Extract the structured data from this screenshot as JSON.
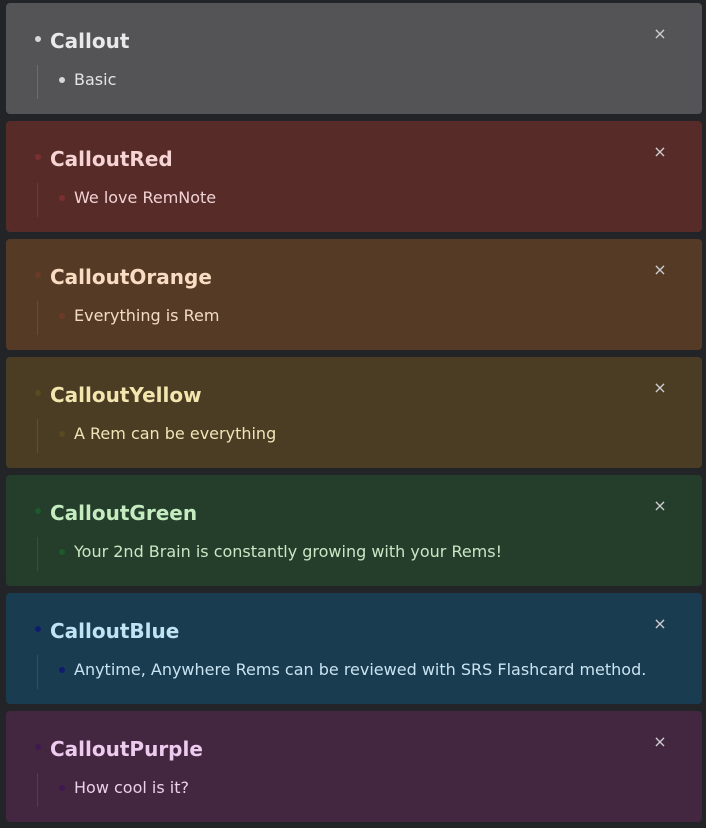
{
  "callouts": [
    {
      "title": "Callout",
      "body": "Basic",
      "close": "×",
      "colors": {
        "bg": "#545456",
        "title": "#e9e9ec",
        "text": "#e4e4e7",
        "bullet": "#d7d7da",
        "line": "#6c6c6f"
      }
    },
    {
      "title": "CalloutRed",
      "body": "We love RemNote",
      "close": "×",
      "colors": {
        "bg": "#562b28",
        "title": "#f6d4d4",
        "text": "#f1d3d3",
        "bullet": "#7c2e30",
        "line": "#6e3b38"
      }
    },
    {
      "title": "CalloutOrange",
      "body": "Everything is Rem",
      "close": "×",
      "colors": {
        "bg": "#553b26",
        "title": "#f9dcc2",
        "text": "#f3dcc6",
        "bullet": "#6e3a28",
        "line": "#6b4b34"
      }
    },
    {
      "title": "CalloutYellow",
      "body": "A Rem can be everything",
      "close": "×",
      "colors": {
        "bg": "#4b3d23",
        "title": "#f3e6ae",
        "text": "#efe5b8",
        "bullet": "#5a4a20",
        "line": "#5f5033"
      }
    },
    {
      "title": "CalloutGreen",
      "body": "Your 2nd Brain is constantly growing with your Rems!",
      "close": "×",
      "colors": {
        "bg": "#253d2b",
        "title": "#c5ecc0",
        "text": "#c9e7c5",
        "bullet": "#1c5a2a",
        "line": "#365040"
      }
    },
    {
      "title": "CalloutBlue",
      "body": "Anytime, Anywhere Rems can be reviewed with SRS Flashcard method.",
      "close": "×",
      "colors": {
        "bg": "#1a3c50",
        "title": "#c1e4f4",
        "text": "#c8e3f1",
        "bullet": "#101d6e",
        "line": "#2c5165"
      }
    },
    {
      "title": "CalloutPurple",
      "body": "How cool is it?",
      "close": "×",
      "colors": {
        "bg": "#43263f",
        "title": "#eccbee",
        "text": "#ebd0ea",
        "bullet": "#3f1850",
        "line": "#583a55"
      }
    }
  ]
}
